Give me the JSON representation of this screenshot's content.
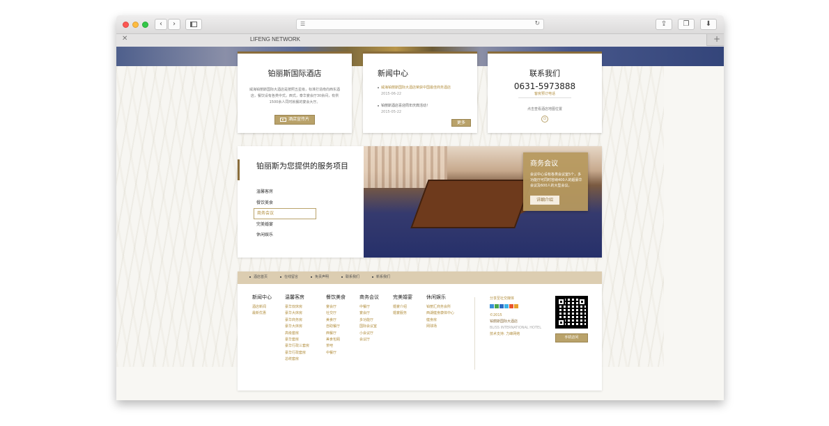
{
  "browser": {
    "tab_title": "LIFENG NETWORK",
    "close_tab": "✕",
    "new_tab": "+"
  },
  "cards": {
    "hotel": {
      "title": "铂丽斯国际酒店",
      "desc": "威海铂丽斯国际大酒店是按照五星级，标准打造南向西东酒店，餐饮设有各类中式，西式，泰华宴会厅30余间，有供1500余人同时就餐的宴会大厅。",
      "button": "酒店宣传片"
    },
    "news": {
      "title": "新闻中心",
      "items": [
        {
          "title": "威海铂丽斯国际大酒店荣获中国最佳商务酒店",
          "date": "2015-06-22"
        },
        {
          "title": "铂丽斯酒店喜迎周年庆典活动！",
          "date": "2015-05-22"
        }
      ],
      "more": "更多"
    },
    "contact": {
      "title": "联系我们",
      "phone": "0631-5973888",
      "phone_sub": "客房预订电话",
      "map_text": "点击查看酒店地图位置",
      "pin": "⊙"
    }
  },
  "services": {
    "title": "铂丽斯为您提供的服务项目",
    "menu": [
      "温馨客房",
      "餐饮美食",
      "商务会议",
      "完美婚宴",
      "休闲娱乐"
    ],
    "active_index": 2,
    "feature": {
      "title": "商务会议",
      "desc": "会议中心设有各类会议室5个，多功能厅可同时容纳400人的超豪华会议及600人的大型会议。",
      "button": "详细介绍"
    }
  },
  "footer": {
    "nav": [
      "酒店首页",
      "在线留言",
      "免责声明",
      "联系我们",
      "新系我们"
    ],
    "columns": [
      {
        "heading": "新闻中心",
        "items": [
          "酒店新闻",
          "最新优惠"
        ]
      },
      {
        "heading": "温馨客房",
        "items": [
          "豪华双床房",
          "豪华大床房",
          "豪华商务房",
          "豪华大床房",
          "高级套房",
          "豪华套房",
          "豪华行政三套房",
          "豪华行政套房",
          "总统套房"
        ]
      },
      {
        "heading": "餐饮美食",
        "items": [
          "宴会厅",
          "社交厅",
          "美食厅",
          "自助餐厅",
          "西餐厅",
          "美食包厢",
          "茶吧",
          "中餐厅"
        ]
      },
      {
        "heading": "商务会议",
        "items": [
          "中餐厅",
          "宴会厅",
          "多功能厅",
          "国际会议室",
          "小会议厅",
          "会议厅"
        ]
      },
      {
        "heading": "完美婚宴",
        "items": [
          "婚宴介绍",
          "婚宴服务"
        ]
      },
      {
        "heading": "休闲娱乐",
        "items": [
          "铂丽汇商务会所",
          "西湖健身康体中心",
          "健身房",
          "网球场"
        ]
      }
    ],
    "social": {
      "heading": "分享至社交媒体",
      "copyright": "©2015",
      "name": "铂丽斯国际大酒店",
      "name_en": "BLISS INTERNATIONAL HOTEL",
      "support": "技术支持: 力峰网络"
    },
    "mobile_button": "手机访问"
  },
  "colors": {
    "gold": "#b9a26a",
    "gold_text": "#b28e3d",
    "dark_gold": "#8a6d3b",
    "footer_nav_bg": "#dccdb1"
  }
}
